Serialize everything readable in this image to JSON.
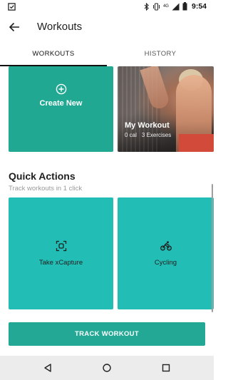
{
  "status_bar": {
    "time": "9:54",
    "network": "4G",
    "icons": [
      "app-notification-icon",
      "bluetooth-icon",
      "vibrate-icon",
      "signal-icon",
      "battery-icon"
    ]
  },
  "app_bar": {
    "title": "Workouts",
    "back_icon": "arrow-back-icon"
  },
  "tabs": [
    {
      "label": "WORKOUTS",
      "active": true
    },
    {
      "label": "HISTORY",
      "active": false
    }
  ],
  "workouts": {
    "create_new": {
      "label": "Create New",
      "icon": "add-circle-icon"
    },
    "my_workout": {
      "title": "My Workout",
      "calories": "0 cal",
      "exercises": "3 Exercises"
    }
  },
  "quick_actions": {
    "title": "Quick Actions",
    "subtitle": "Track workouts in 1 click",
    "items": [
      {
        "label": "Take xCapture",
        "icon": "xcapture-icon"
      },
      {
        "label": "Cycling",
        "icon": "cycling-icon"
      }
    ]
  },
  "track_button": {
    "label": "TRACK WORKOUT"
  },
  "nav_bar": {
    "icons": [
      "nav-back-icon",
      "nav-home-icon",
      "nav-recents-icon"
    ]
  },
  "colors": {
    "primary_green": "#20a893",
    "quick_action_teal": "#22bdb5",
    "text_dark": "#1f1f1f",
    "text_muted": "#9a9a9a"
  }
}
